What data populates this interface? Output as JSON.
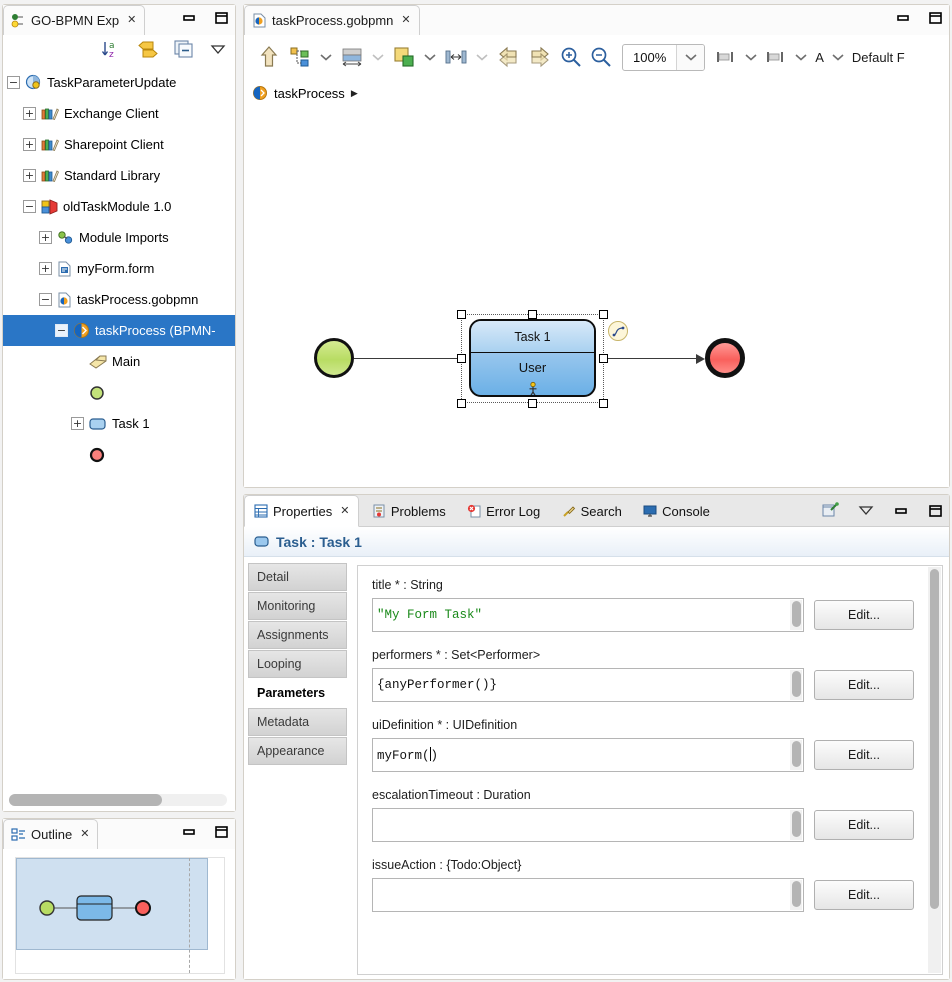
{
  "explorer": {
    "title": "GO-BPMN Exp",
    "close_label": "✕",
    "toolbar": [
      {
        "name": "sort-icon",
        "title": "Sort"
      },
      {
        "name": "link-with-editor-icon",
        "title": "Link with Editor"
      },
      {
        "name": "collapse-all-icon",
        "title": "Collapse All"
      },
      {
        "name": "view-menu-icon",
        "title": "View Menu"
      }
    ],
    "tree": [
      {
        "label": "TaskParameterUpdate",
        "indent": 0,
        "twist": "−",
        "icon": "project-icon",
        "selected": false
      },
      {
        "label": "Exchange Client",
        "indent": 1,
        "twist": "+",
        "icon": "library-icon",
        "selected": false
      },
      {
        "label": "Sharepoint Client",
        "indent": 1,
        "twist": "+",
        "icon": "library-icon",
        "selected": false
      },
      {
        "label": "Standard Library",
        "indent": 1,
        "twist": "+",
        "icon": "library-icon",
        "selected": false
      },
      {
        "label": "oldTaskModule 1.0",
        "indent": 1,
        "twist": "−",
        "icon": "module-icon",
        "selected": false
      },
      {
        "label": "Module Imports",
        "indent": 2,
        "twist": "+",
        "icon": "imports-icon",
        "selected": false
      },
      {
        "label": "myForm.form",
        "indent": 2,
        "twist": "+",
        "icon": "form-file-icon",
        "selected": false
      },
      {
        "label": "taskProcess.gobpmn",
        "indent": 2,
        "twist": "−",
        "icon": "gobpmn-file-icon",
        "selected": false
      },
      {
        "label": "taskProcess (BPMN-",
        "indent": 3,
        "twist": "−",
        "icon": "process-icon",
        "selected": true
      },
      {
        "label": "Main",
        "indent": 4,
        "twist": "",
        "icon": "main-pool-icon",
        "selected": false
      },
      {
        "label": "",
        "indent": 4,
        "twist": "",
        "icon": "start-event-icon",
        "selected": false
      },
      {
        "label": "Task 1",
        "indent": 4,
        "twist": "+",
        "icon": "task-icon",
        "selected": false
      },
      {
        "label": "",
        "indent": 4,
        "twist": "",
        "icon": "end-event-icon",
        "selected": false
      }
    ]
  },
  "outline": {
    "title": "Outline",
    "close_label": "✕"
  },
  "editor": {
    "tab_title": "taskProcess.gobpmn",
    "close_label": "✕",
    "toolbar": {
      "zoom_value": "100%",
      "items": [
        {
          "name": "parent-up-icon",
          "caret": false
        },
        {
          "name": "align-tree-icon",
          "caret": true
        },
        {
          "name": "grid-icon",
          "caret": true,
          "caret_dim": true
        },
        {
          "name": "fill-color-icon",
          "caret": true
        },
        {
          "name": "distribute-icon",
          "caret": true,
          "caret_dim": true
        },
        {
          "name": "undo-arrow-icon",
          "caret": false
        },
        {
          "name": "redo-arrow-icon",
          "caret": false
        },
        {
          "name": "zoom-in-icon",
          "caret": false
        },
        {
          "name": "zoom-out-icon",
          "caret": false
        }
      ],
      "align_items": [
        {
          "name": "align-left-icon",
          "caret": true
        },
        {
          "name": "align-middle-icon",
          "caret": true
        },
        {
          "name": "font-size-icon",
          "label": "A",
          "caret": true
        }
      ],
      "font_label": "Default F"
    },
    "breadcrumb": {
      "label": "taskProcess",
      "separator": "▶"
    },
    "diagram": {
      "start_event": {
        "name": "start-event"
      },
      "task": {
        "title": "Task 1",
        "subtitle": "User",
        "icon": "user-task-icon"
      },
      "end_event": {
        "name": "end-event"
      },
      "connector_badge": {
        "name": "sequence-flow-badge"
      }
    }
  },
  "properties": {
    "tabs": [
      {
        "label": "Properties",
        "icon": "properties-icon",
        "active": true,
        "close": "✕"
      },
      {
        "label": "Problems",
        "icon": "problems-icon",
        "active": false
      },
      {
        "label": "Error Log",
        "icon": "error-log-icon",
        "active": false
      },
      {
        "label": "Search",
        "icon": "search-icon",
        "active": false
      },
      {
        "label": "Console",
        "icon": "console-icon",
        "active": false
      }
    ],
    "toolbar": [
      {
        "name": "pin-icon"
      },
      {
        "name": "view-menu-icon"
      },
      {
        "name": "minimize-icon"
      },
      {
        "name": "maximize-icon"
      }
    ],
    "header": {
      "icon": "task-icon",
      "title": "Task : Task 1"
    },
    "side_tabs": [
      {
        "label": "Detail",
        "active": false
      },
      {
        "label": "Monitoring",
        "active": false
      },
      {
        "label": "Assignments",
        "active": false
      },
      {
        "label": "Looping",
        "active": false
      },
      {
        "label": "Parameters",
        "active": true
      },
      {
        "label": "Metadata",
        "active": false
      },
      {
        "label": "Appearance",
        "active": false
      }
    ],
    "fields": [
      {
        "label": "title *  : String",
        "value": "\"My Form Task\"",
        "value_kind": "string",
        "caret": false,
        "button": "Edit..."
      },
      {
        "label": "performers *  : Set<Performer>",
        "value": "{anyPerformer()}",
        "value_kind": "plain",
        "caret": false,
        "button": "Edit..."
      },
      {
        "label": "uiDefinition *  : UIDefinition",
        "value": "myForm()",
        "value_kind": "plain",
        "caret": true,
        "caret_after": 7,
        "button": "Edit..."
      },
      {
        "label": "escalationTimeout  : Duration",
        "value": "",
        "value_kind": "plain",
        "caret": false,
        "button": "Edit..."
      },
      {
        "label": "issueAction  : {Todo:Object}",
        "value": "",
        "value_kind": "plain",
        "caret": false,
        "button": "Edit..."
      }
    ]
  },
  "window_controls": {
    "minimize": "minimize-icon",
    "maximize": "maximize-icon"
  },
  "colors": {
    "selection_blue": "#2a76c6",
    "start_green": "#b8dc63",
    "end_red": "#f9605c",
    "task_blue": "#6bb0e6",
    "string_green": "#1a8a1a",
    "header_text": "#2a5d8f"
  }
}
